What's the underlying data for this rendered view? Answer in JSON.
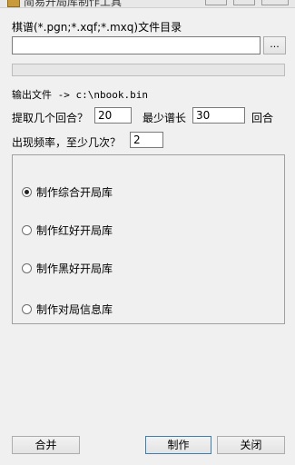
{
  "window": {
    "title": "简易开局库制作工具"
  },
  "dir": {
    "label": "棋谱(*.pgn;*.xqf;*.mxq)文件目录",
    "value": "",
    "browse_label": "..."
  },
  "progress": {
    "value": 0
  },
  "output": {
    "text": "输出文件 -> c:\\nbook.bin"
  },
  "options": {
    "rounds_label": "提取几个回合？",
    "rounds_value": "20",
    "min_length_label": "最少谱长",
    "min_length_value": "30",
    "min_length_unit": "回合",
    "freq_label": "出现频率，至少几次？",
    "freq_value": "2"
  },
  "modes": [
    {
      "label": "制作综合开局库",
      "checked": true
    },
    {
      "label": "制作红好开局库",
      "checked": false
    },
    {
      "label": "制作黑好开局库",
      "checked": false
    },
    {
      "label": "制作对局信息库",
      "checked": false
    }
  ],
  "buttons": {
    "merge": "合并",
    "make": "制作",
    "close": "关闭"
  }
}
